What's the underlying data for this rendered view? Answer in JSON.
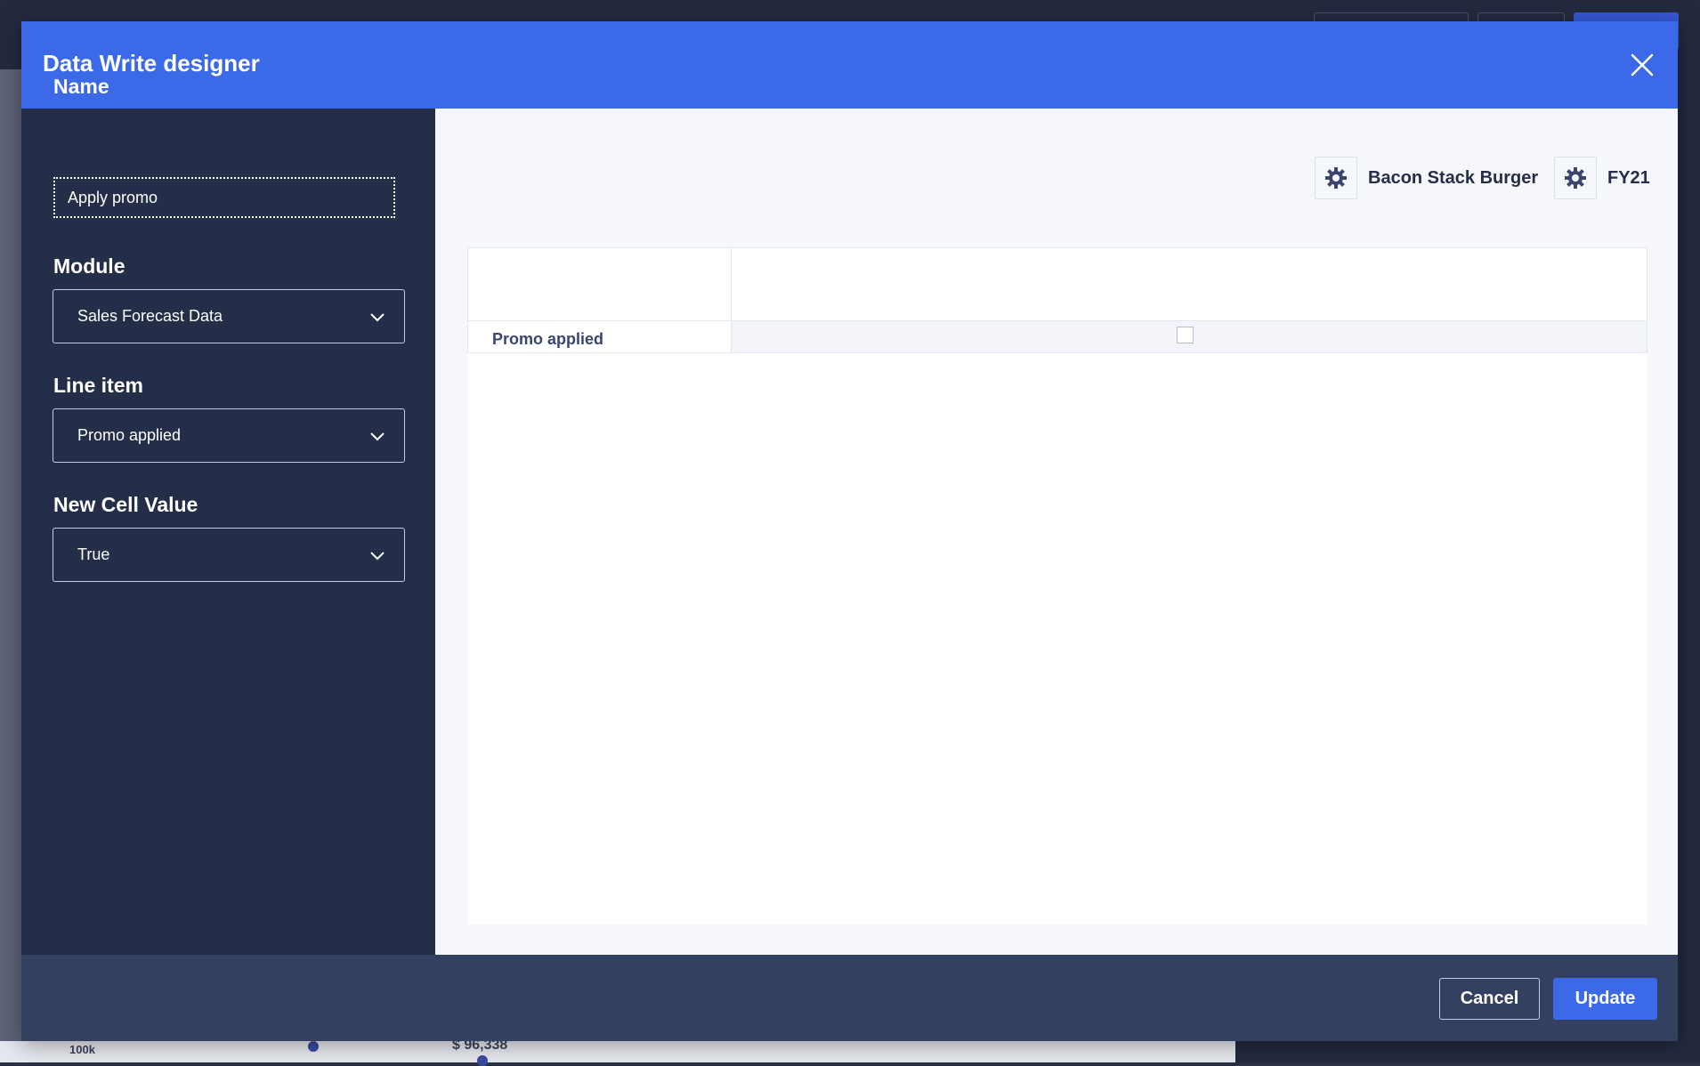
{
  "background": {
    "axis_tick": "100k",
    "metric_value": "$ 96,338"
  },
  "dialog": {
    "title": "Data Write designer",
    "close_icon": "close-icon"
  },
  "form": {
    "name_label": "Name",
    "name_value": "Apply promo",
    "module_label": "Module",
    "module_value": "Sales Forecast Data",
    "line_item_label": "Line item",
    "line_item_value": "Promo applied",
    "new_cell_value_label": "New Cell Value",
    "new_cell_value": "True"
  },
  "preview": {
    "dimensions": [
      {
        "label": "Bacon Stack Burger",
        "icon": "gear-icon"
      },
      {
        "label": "FY21",
        "icon": "gear-icon"
      }
    ],
    "grid": {
      "row_label": "Promo applied",
      "checked": false
    }
  },
  "footer": {
    "cancel_label": "Cancel",
    "update_label": "Update"
  },
  "colors": {
    "header_blue": "#3b69e8",
    "panel_dark": "#252e48",
    "footer": "#344060"
  }
}
